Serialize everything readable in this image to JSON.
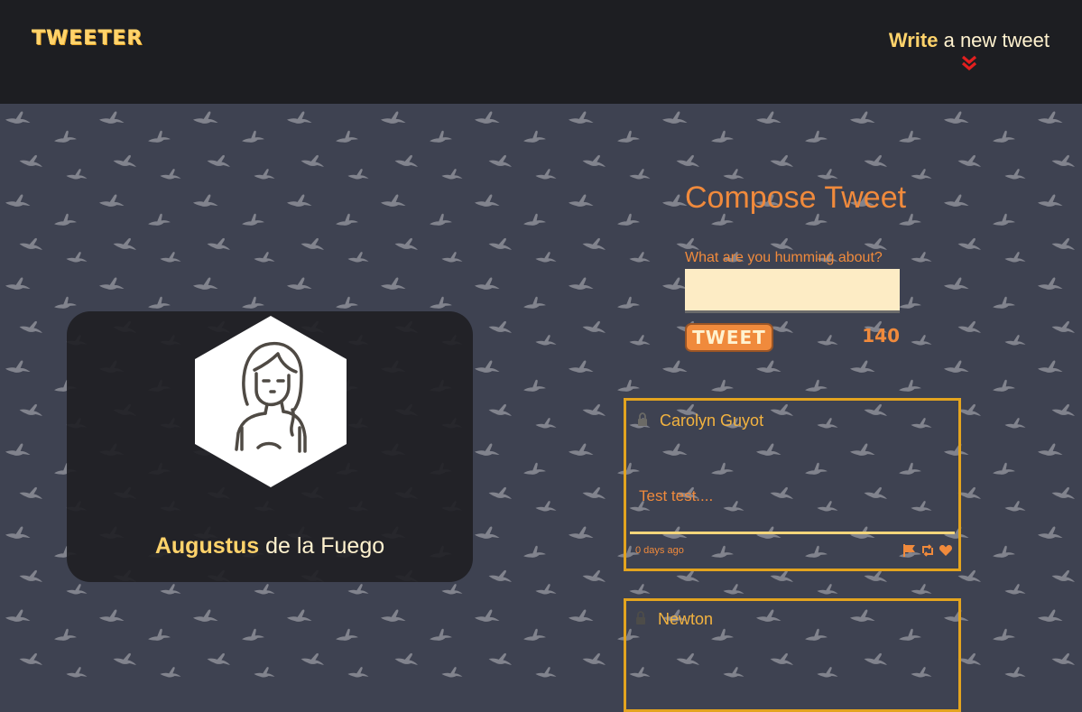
{
  "nav": {
    "brand": "TWEETER",
    "compose_strong": "Write",
    "compose_rest": "a new tweet"
  },
  "profile": {
    "first_name": "Augustus",
    "last_name": "de la Fuego"
  },
  "compose": {
    "title": "Compose Tweet",
    "label": "What are you humming about?",
    "input_value": "",
    "button_label": "TWEET",
    "counter": "140"
  },
  "tweets": [
    {
      "author": "Carolyn Guyot",
      "text": "Test test....",
      "time": "0 days ago",
      "icons": [
        "flag-icon",
        "retweet-icon",
        "heart-icon"
      ]
    },
    {
      "author": "Newton",
      "text": "",
      "time": "",
      "icons": []
    }
  ],
  "colors": {
    "nav_bg": "#1d1e22",
    "page_bg": "#3e4251",
    "accent_yellow": "#ffd36b",
    "accent_orange": "#f08a3c",
    "tweet_border": "#e3a41f"
  }
}
